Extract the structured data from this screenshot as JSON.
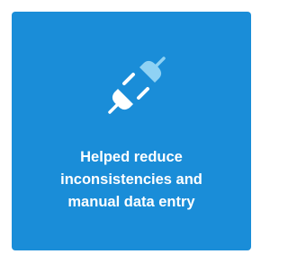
{
  "card": {
    "background_color": "#1a8dd8",
    "icon": "plug-connection-icon",
    "icon_colors": {
      "plug": "#ffffff",
      "socket": "#8fd2f4"
    },
    "caption_lines": [
      "Helped reduce",
      "inconsistencies and",
      "manual data entry"
    ]
  }
}
